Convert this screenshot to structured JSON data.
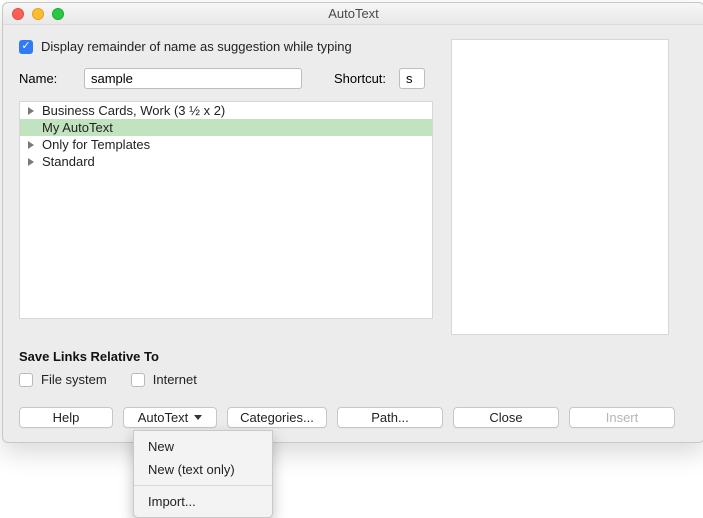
{
  "window": {
    "title": "AutoText"
  },
  "suggest": {
    "label": "Display remainder of name as suggestion while typing",
    "checked": true
  },
  "name": {
    "label": "Name:",
    "value": "sample"
  },
  "shortcut": {
    "label": "Shortcut:",
    "value": "s"
  },
  "tree": {
    "items": [
      {
        "label": "Business Cards, Work (3 ½ x 2)",
        "selected": false,
        "expandable": true
      },
      {
        "label": "My AutoText",
        "selected": true,
        "expandable": false
      },
      {
        "label": "Only for Templates",
        "selected": false,
        "expandable": true
      },
      {
        "label": "Standard",
        "selected": false,
        "expandable": true
      }
    ]
  },
  "links": {
    "section": "Save Links Relative To",
    "filesystem": {
      "label": "File system",
      "checked": false
    },
    "internet": {
      "label": "Internet",
      "checked": false
    }
  },
  "buttons": {
    "help": "Help",
    "autotext": "AutoText",
    "categories": "Categories...",
    "path": "Path...",
    "close": "Close",
    "insert": "Insert"
  },
  "menu": {
    "new": "New",
    "new_text_only": "New (text only)",
    "import": "Import..."
  }
}
